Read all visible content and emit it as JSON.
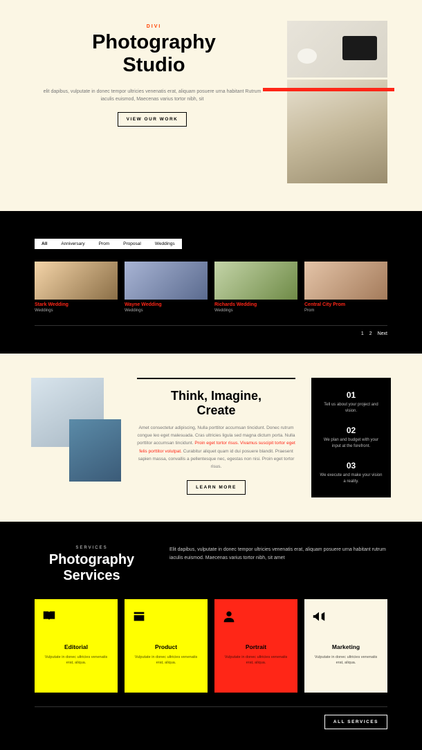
{
  "hero": {
    "pretitle": "DIVI",
    "title_line1": "Photography",
    "title_line2": "Studio",
    "paragraph": "elit dapibus, vulputate in donec tempor ultricies venenatis erat, aliquam posuere urna habitant Rutrum iaculis euismod, Maecenas varius tortor nibh, sit",
    "button": "VIEW OUR WORK"
  },
  "portfolio": {
    "filters": [
      "All",
      "Anniversary",
      "Prom",
      "Proposal",
      "Weddings"
    ],
    "items": [
      {
        "title": "Stark Wedding",
        "category": "Weddings"
      },
      {
        "title": "Wayne Wedding",
        "category": "Weddings"
      },
      {
        "title": "Richards Wedding",
        "category": "Weddings"
      },
      {
        "title": "Central City Prom",
        "category": "Prom"
      }
    ],
    "pagination": {
      "p1": "1",
      "p2": "2",
      "next": "Next"
    }
  },
  "think": {
    "title_line1": "Think, Imagine,",
    "title_line2": "Create",
    "para_pre": "Amet consectetur adipiscing, Nulla porttitor accumsan tincidunt. Donec rutrum congue leo eget malesuada. Cras ultricies ligula sed magna dictum porta. Nulla porttitor accumsan tincidunt. ",
    "para_red": "Proin eget tortor risus. Vivamus suscipit tortor eget felis porttitor volutpat.",
    "para_post": " Curabitur aliquet quam id dui posuere blandit. Praesent sapien massa, convallis a pellentesque nec, egestas non nisi. Proin eget tortor risus.",
    "button": "LEARN MORE",
    "steps": [
      {
        "num": "01",
        "text": "Tell us about your project and vision."
      },
      {
        "num": "02",
        "text": "We plan and budget with your input at the forefront."
      },
      {
        "num": "03",
        "text": "We execute and make your vision a reality."
      }
    ]
  },
  "services": {
    "pretitle": "SERVICES",
    "title_line1": "Photography",
    "title_line2": "Services",
    "paragraph": "Elit dapibus, vulputate in donec tempor ultricies venenatis erat, aliquam posuere urna habitant rutrum iaculis euismod. Maecenas varius tortor nibh, sit amet",
    "cards": [
      {
        "title": "Editorial",
        "desc": "Vulputate in donec ultricies venenatis erat, aliqua."
      },
      {
        "title": "Product",
        "desc": "Vulputate in donec ultricies venenatis erat, aliqua."
      },
      {
        "title": "Portrait",
        "desc": "Vulputate in donec ultricies venenatis erat, aliqua."
      },
      {
        "title": "Marketing",
        "desc": "Vulputate in donec ultricies venenatis erat, aliqua."
      }
    ],
    "button": "ALL SERVICES"
  }
}
